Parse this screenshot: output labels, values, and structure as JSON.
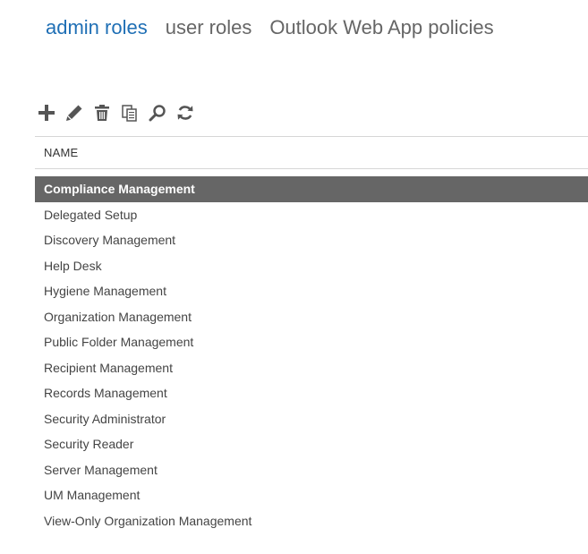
{
  "tabs": [
    {
      "label": "admin roles",
      "active": true
    },
    {
      "label": "user roles",
      "active": false
    },
    {
      "label": "Outlook Web App policies",
      "active": false
    }
  ],
  "toolbar": {
    "icons": [
      "add-icon",
      "edit-icon",
      "delete-icon",
      "copy-icon",
      "search-icon",
      "refresh-icon"
    ]
  },
  "grid": {
    "column_header": "NAME",
    "selected_index": 0,
    "rows": [
      "Compliance Management",
      "Delegated Setup",
      "Discovery Management",
      "Help Desk",
      "Hygiene Management",
      "Organization Management",
      "Public Folder Management",
      "Recipient Management",
      "Records Management",
      "Security Administrator",
      "Security Reader",
      "Server Management",
      "UM Management",
      "View-Only Organization Management"
    ]
  },
  "colors": {
    "active_tab": "#1f6fb5",
    "selected_row_bg": "#666666",
    "icon": "#555555"
  }
}
